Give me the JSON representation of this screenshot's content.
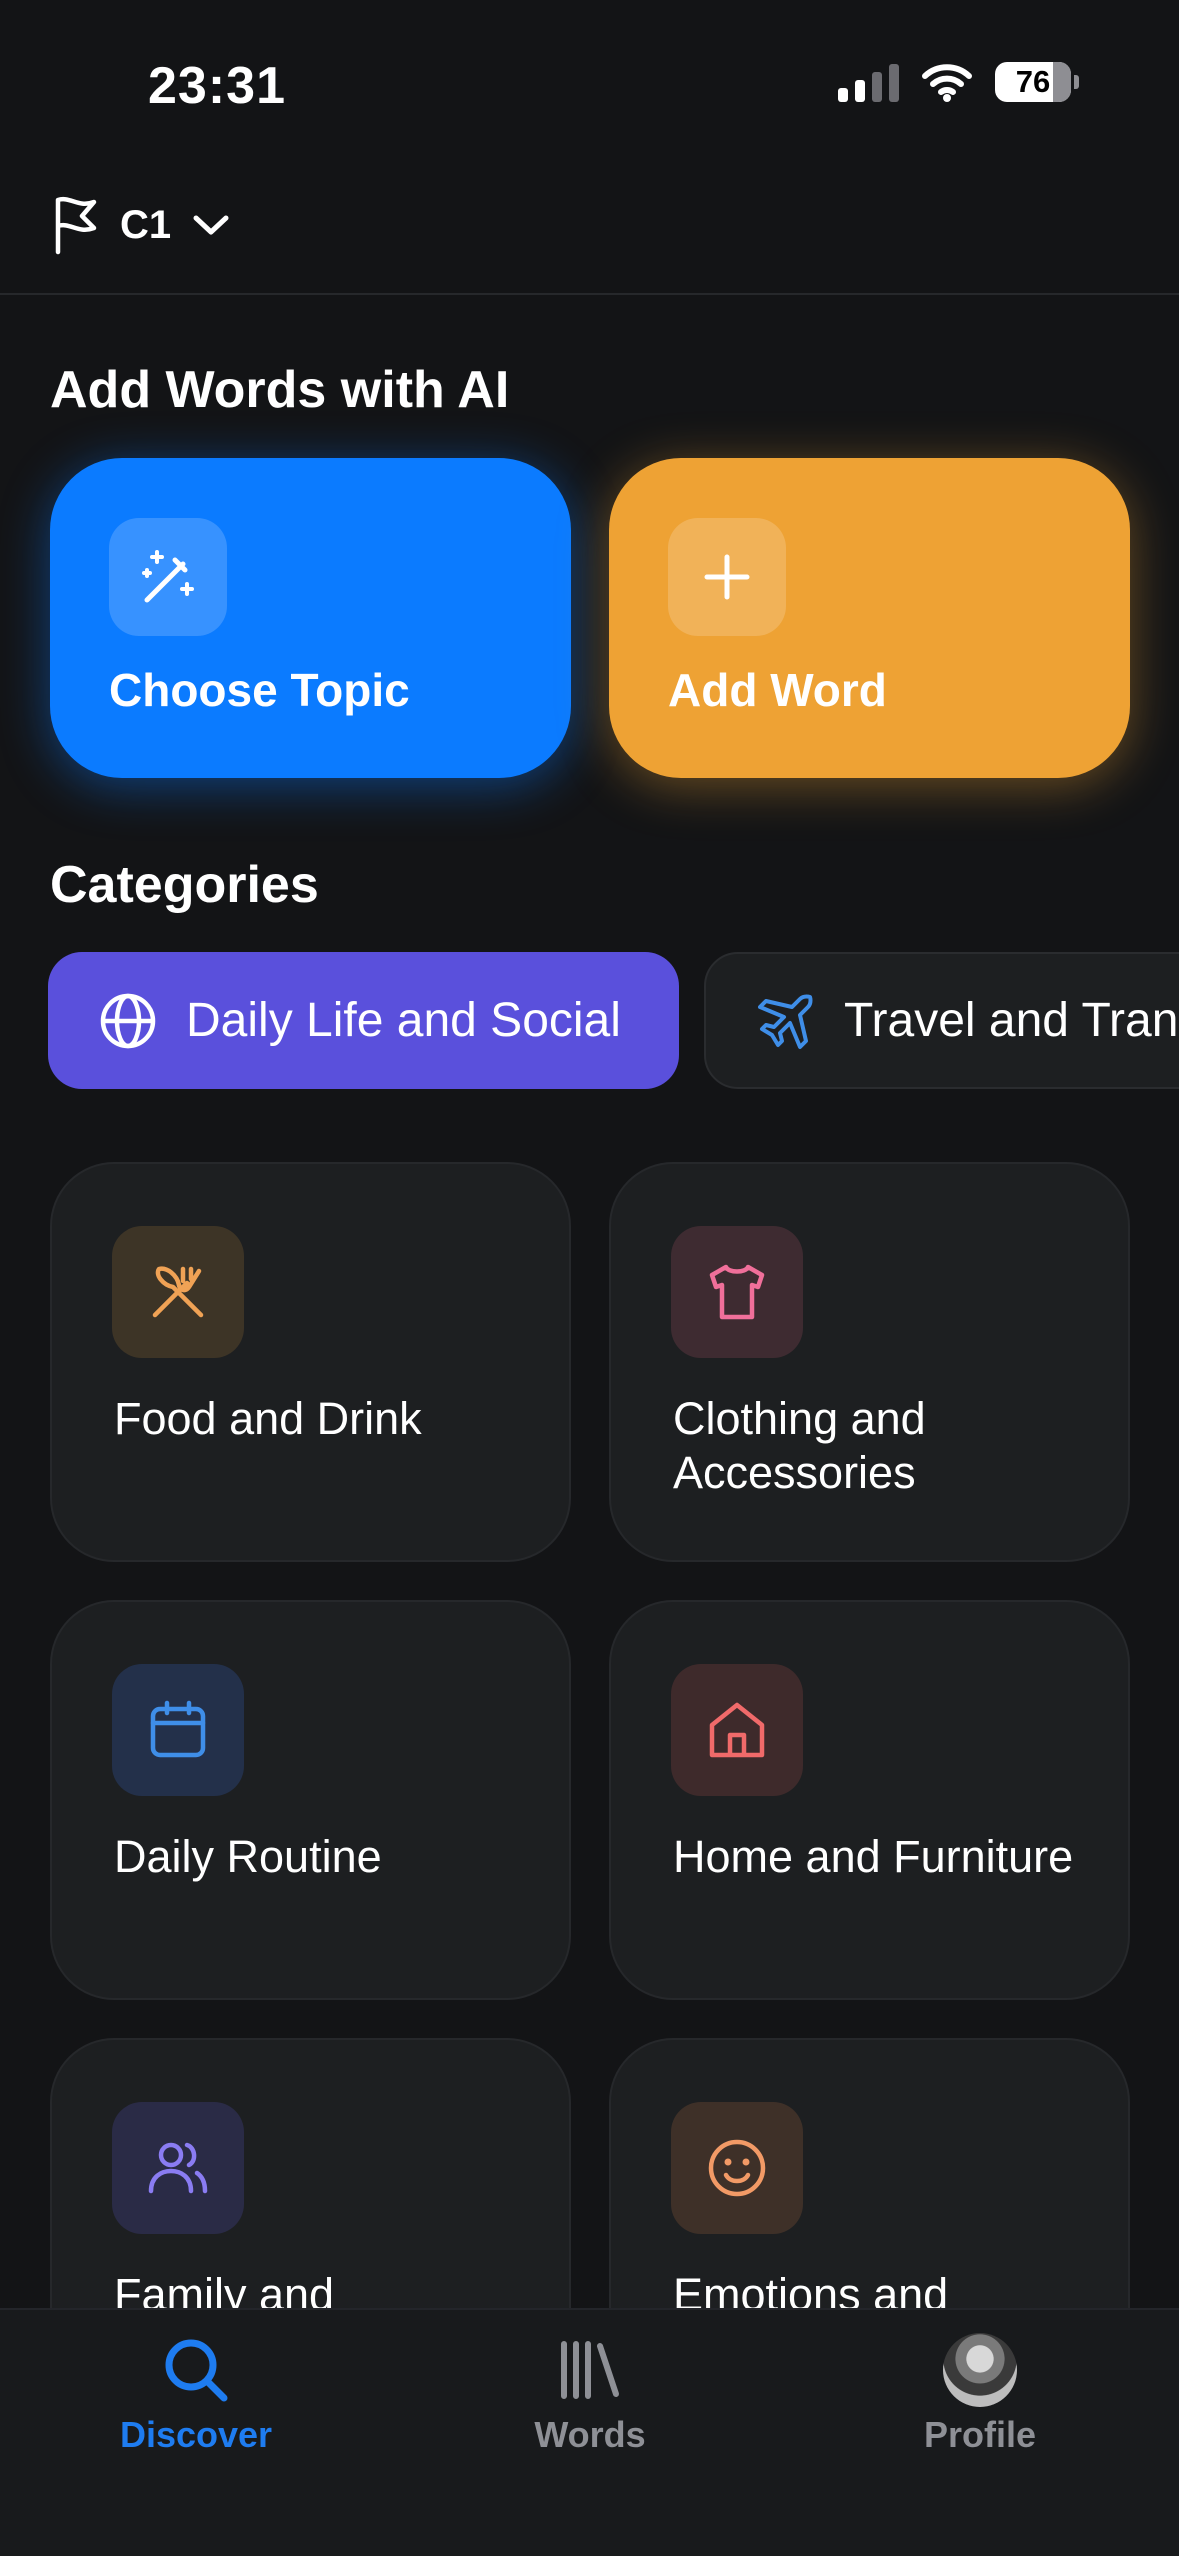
{
  "status_bar": {
    "time": "23:31",
    "battery": "76"
  },
  "header": {
    "level": "C1"
  },
  "ai_section": {
    "title": "Add Words with AI",
    "cards": [
      {
        "label": "Choose Topic",
        "icon": "magic-wand-icon",
        "color": "#0b7bff"
      },
      {
        "label": "Add Word",
        "icon": "plus-icon",
        "color": "#eea234"
      }
    ]
  },
  "categories": {
    "title": "Categories",
    "chips": [
      {
        "label": "Daily Life and Social",
        "icon": "globe-icon",
        "active": true
      },
      {
        "label": "Travel and Tran",
        "icon": "airplane-icon",
        "active": false
      }
    ]
  },
  "topics": [
    {
      "label": "Food and Drink",
      "icon": "utensils-icon",
      "color": "#f0a255"
    },
    {
      "label": "Clothing and Accessories",
      "icon": "shirt-icon",
      "color": "#f06f9a"
    },
    {
      "label": "Daily Routine",
      "icon": "calendar-icon",
      "color": "#3f8ee8"
    },
    {
      "label": "Home and Furniture",
      "icon": "house-icon",
      "color": "#f06a6a"
    },
    {
      "label": "Family and",
      "icon": "users-icon",
      "color": "#8a7cf2"
    },
    {
      "label": "Emotions and",
      "icon": "smile-icon",
      "color": "#f29a66"
    }
  ],
  "tab_bar": {
    "tabs": [
      {
        "label": "Discover",
        "icon": "search-icon",
        "active": true
      },
      {
        "label": "Words",
        "icon": "library-icon",
        "active": false
      },
      {
        "label": "Profile",
        "icon": "avatar",
        "active": false
      }
    ]
  }
}
